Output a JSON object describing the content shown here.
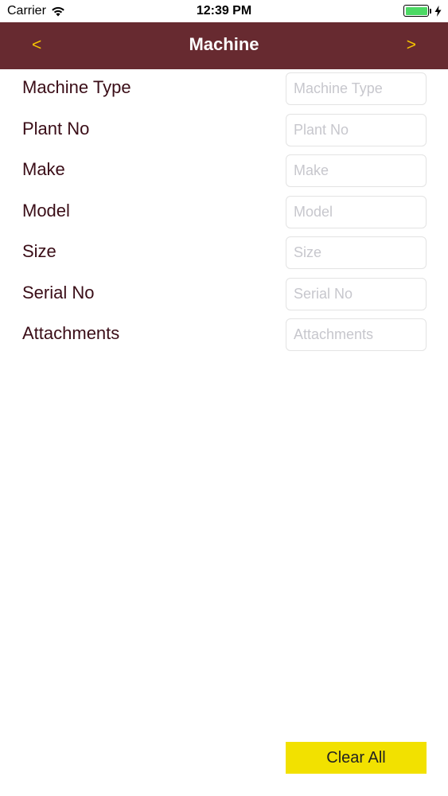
{
  "status_bar": {
    "carrier": "Carrier",
    "time": "12:39 PM",
    "battery_color": "#4cd964"
  },
  "nav": {
    "title": "Machine",
    "back_label": "<",
    "forward_label": ">",
    "background_color": "#672a30",
    "accent_color": "#f5c400"
  },
  "form": {
    "fields": [
      {
        "label": "Machine Type",
        "placeholder": "Machine Type",
        "value": ""
      },
      {
        "label": "Plant No",
        "placeholder": "Plant No",
        "value": ""
      },
      {
        "label": "Make",
        "placeholder": "Make",
        "value": ""
      },
      {
        "label": "Model",
        "placeholder": "Model",
        "value": ""
      },
      {
        "label": "Size",
        "placeholder": "Size",
        "value": ""
      },
      {
        "label": "Serial No",
        "placeholder": "Serial No",
        "value": ""
      },
      {
        "label": "Attachments",
        "placeholder": "Attachments",
        "value": ""
      }
    ]
  },
  "actions": {
    "clear_all_label": "Clear All",
    "clear_all_color": "#f2e100"
  }
}
